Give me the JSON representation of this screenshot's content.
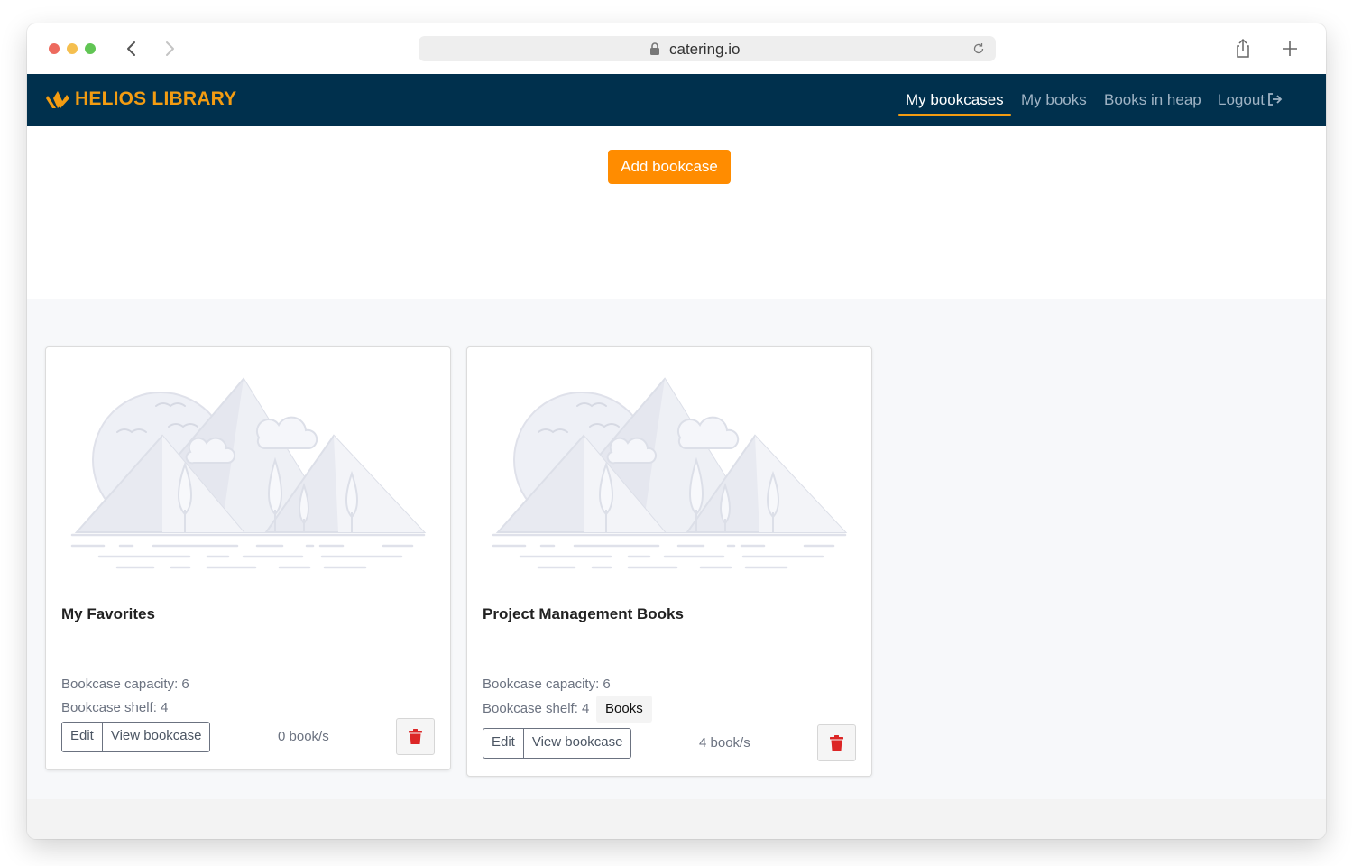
{
  "browser": {
    "url": "catering.io"
  },
  "navbar": {
    "brand": "HELIOS LIBRARY",
    "links": [
      {
        "label": "My bookcases",
        "active": true
      },
      {
        "label": "My books",
        "active": false
      },
      {
        "label": "Books in heap",
        "active": false
      },
      {
        "label": "Logout",
        "active": false
      }
    ]
  },
  "main": {
    "add_button": "Add bookcase"
  },
  "cards": [
    {
      "title": "My Favorites",
      "capacity": "Bookcase capacity: 6",
      "shelf": "Bookcase shelf: 4",
      "edit_label": "Edit",
      "view_label": "View bookcase",
      "count": "0 book/s"
    },
    {
      "title": "Project Management Books",
      "capacity": "Bookcase capacity: 6",
      "shelf": "Bookcase shelf: 4",
      "tooltip": "Books",
      "edit_label": "Edit",
      "view_label": "View bookcase",
      "count": "4 book/s"
    }
  ],
  "colors": {
    "navbar_bg": "#00304d",
    "brand": "#f39c12",
    "accent_button": "#ff8c00",
    "danger": "#dc2626"
  }
}
